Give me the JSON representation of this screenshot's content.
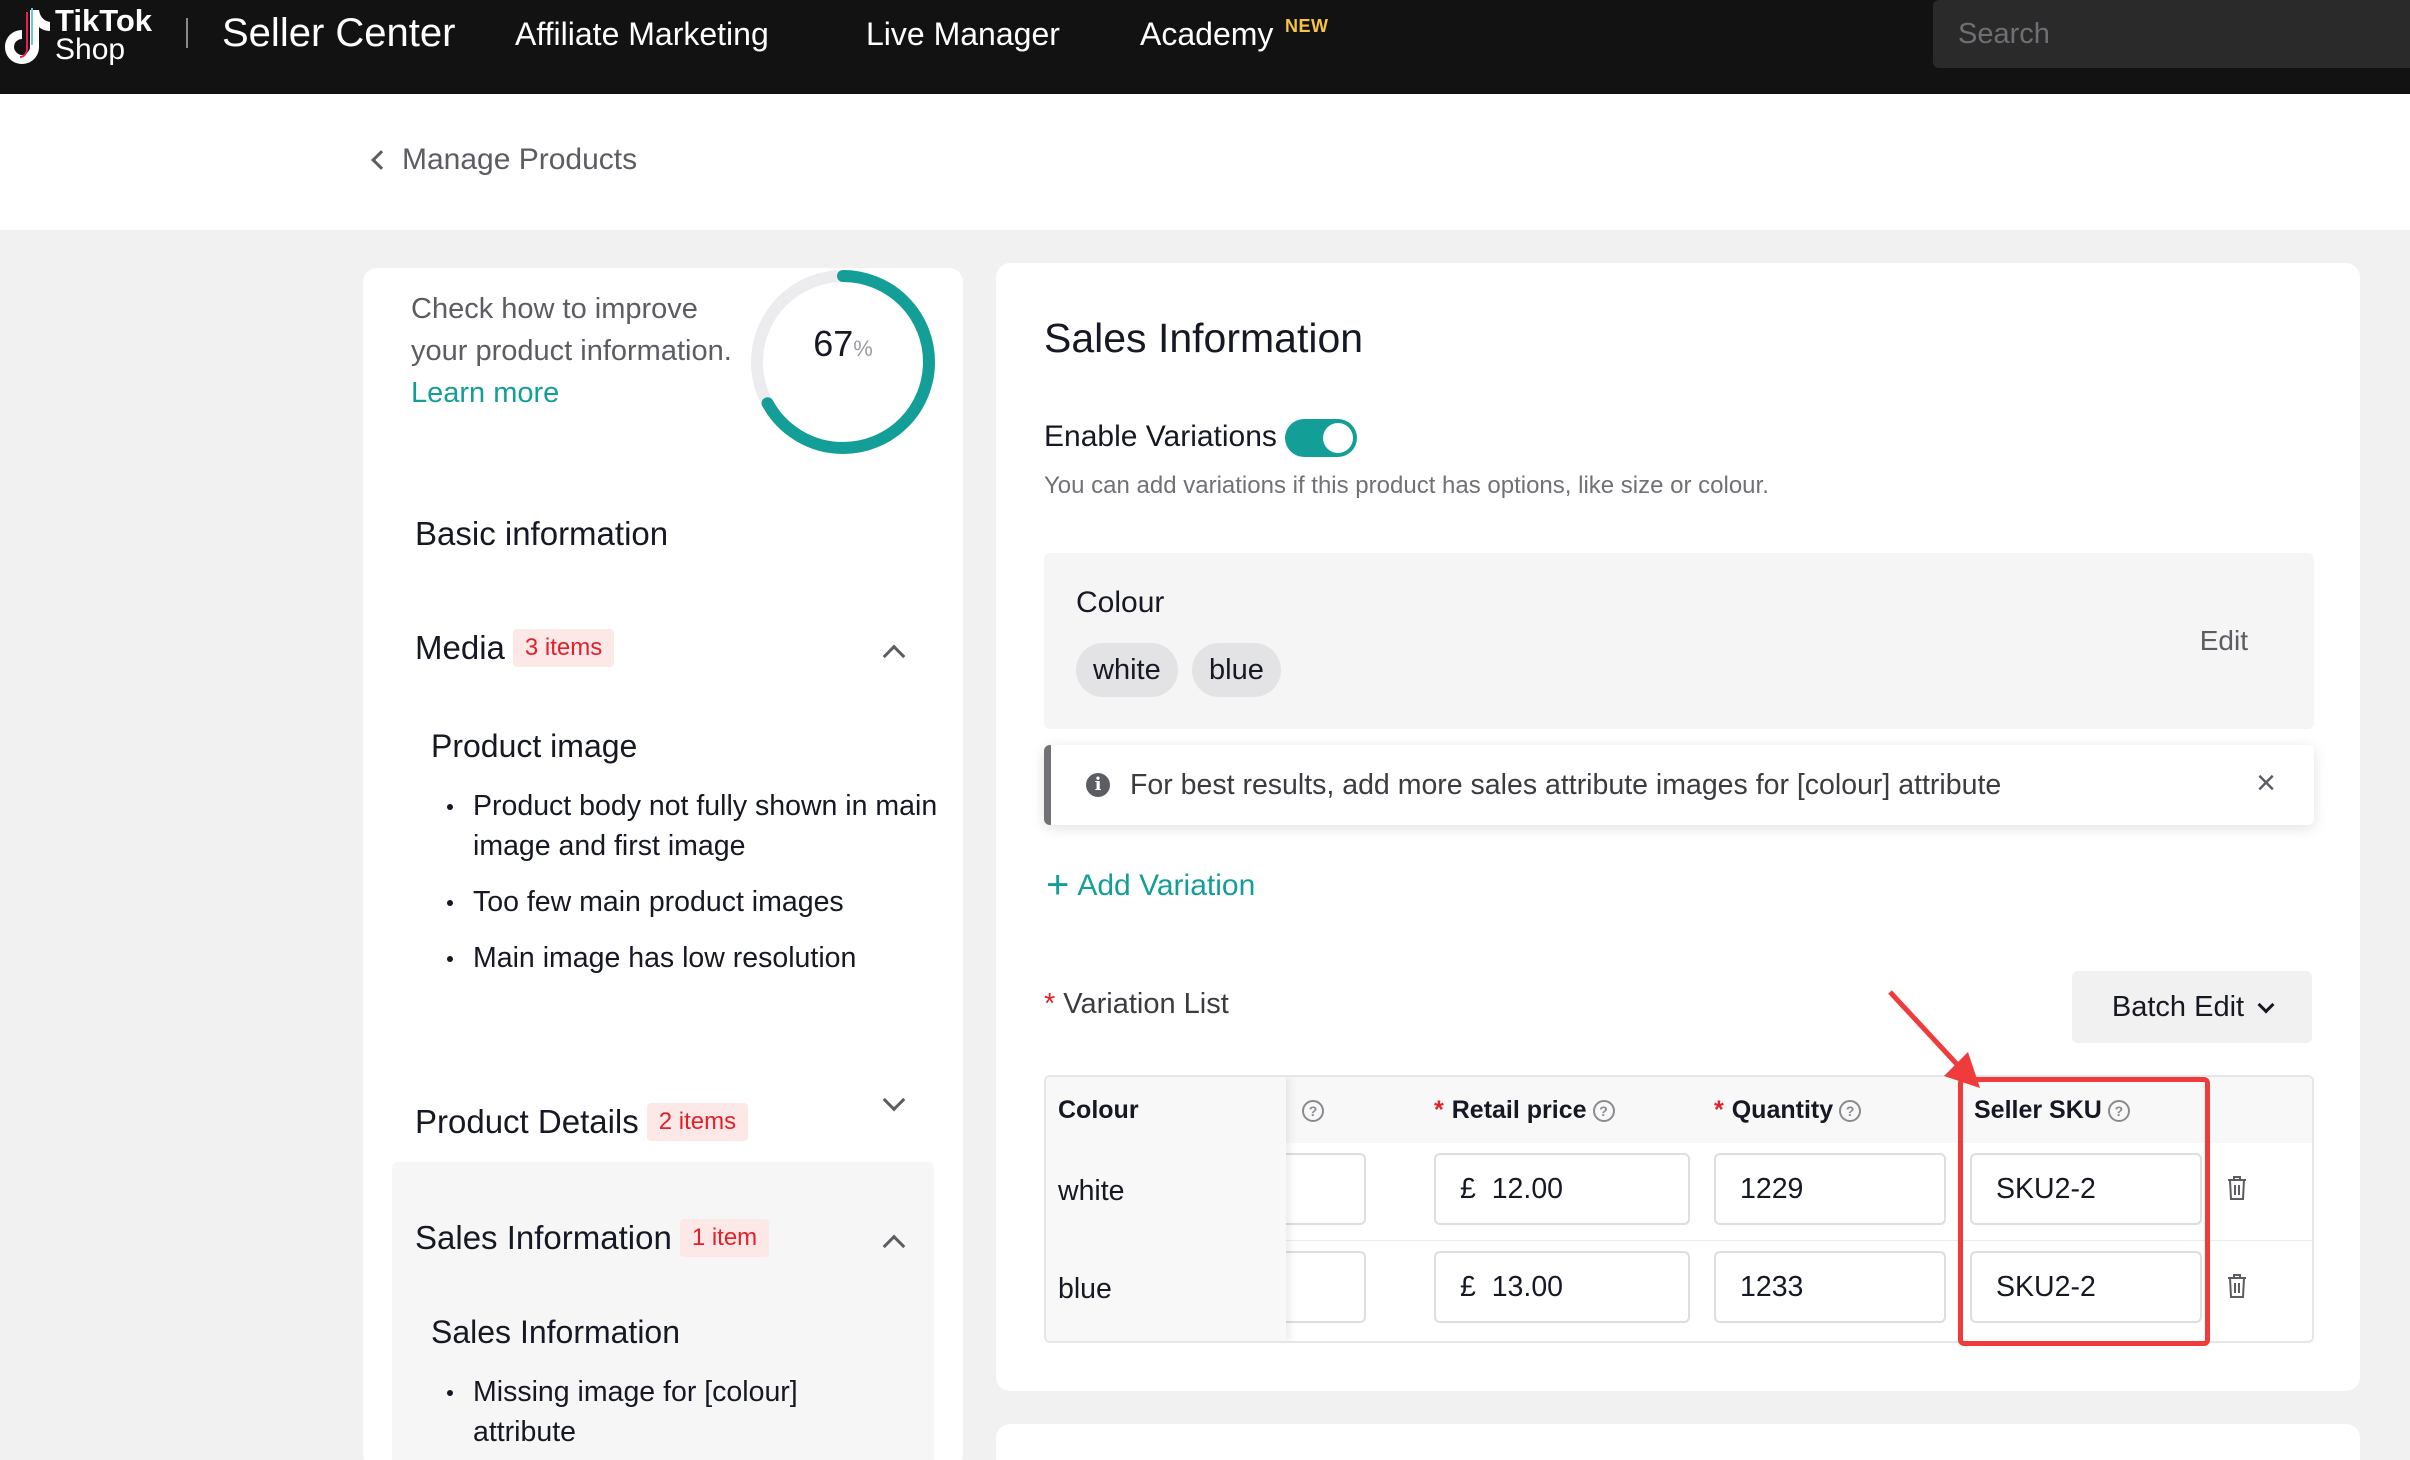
{
  "topbar": {
    "logo_line1": "TikTok",
    "logo_line2": "Shop",
    "title": "Seller Center",
    "nav": [
      "Affiliate Marketing",
      "Live Manager",
      "Academy"
    ],
    "new_badge": "NEW",
    "search_placeholder": "Search"
  },
  "subheader": {
    "back_label": "Manage Products"
  },
  "score": {
    "text": "Check how to improve your product information.",
    "learn_more": "Learn more",
    "value": "67",
    "unit": "%",
    "progress_percent": 67
  },
  "sidebar": {
    "basic_info": "Basic information",
    "media": {
      "title": "Media",
      "badge": "3 items"
    },
    "product_image": {
      "title": "Product image",
      "bullets": [
        "Product body not fully shown in main image and first image",
        "Too few main product images",
        "Main image has low resolution"
      ]
    },
    "product_details": {
      "title": "Product Details",
      "badge": "2 items"
    },
    "sales_info": {
      "title": "Sales Information",
      "badge": "1 item",
      "sub_title": "Sales Information",
      "bullets": [
        "Missing image for [colour] attribute"
      ]
    }
  },
  "main": {
    "title": "Sales Information",
    "enable_variations": "Enable Variations",
    "enable_variations_desc": "You can add variations if this product has options, like size or colour.",
    "colour_label": "Colour",
    "chips": [
      "white",
      "blue"
    ],
    "edit_label": "Edit",
    "notice": "For best results, add more sales attribute images for [colour] attribute",
    "add_variation": "Add Variation",
    "variation_list": "Variation List",
    "batch_edit": "Batch Edit",
    "table": {
      "headers": {
        "colour": "Colour",
        "retail_price": "Retail price",
        "quantity": "Quantity",
        "seller_sku": "Seller SKU"
      },
      "currency": "£",
      "rows": [
        {
          "colour": "white",
          "price": "12.00",
          "quantity": "1229",
          "sku": "SKU2-2"
        },
        {
          "colour": "blue",
          "price": "13.00",
          "quantity": "1233",
          "sku": "SKU2-2"
        }
      ]
    }
  },
  "colors": {
    "accent": "#139e97",
    "badge_red": "#e3202a",
    "highlight": "#ef3b3b"
  }
}
